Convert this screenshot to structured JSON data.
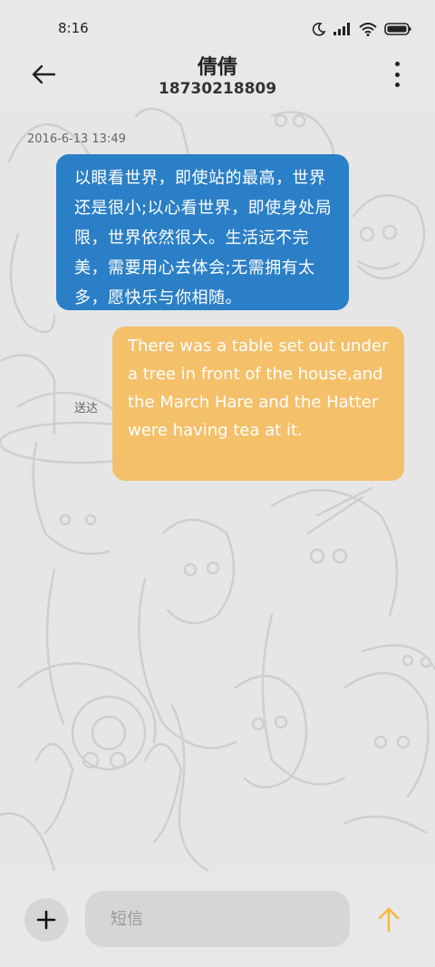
{
  "status_bar": {
    "time": "8:16",
    "icons": [
      "moon-icon",
      "signal-icon",
      "wifi-icon",
      "battery-icon"
    ]
  },
  "header": {
    "title": "倩倩",
    "phone": "18730218809",
    "back_icon": "arrow-left-icon",
    "more_icon": "more-vertical-icon"
  },
  "messages": [
    {
      "direction": "incoming",
      "timestamp": "2016-6-13 13:49",
      "text": "以眼看世界，即使站的最高，世界还是很小;以心看世界，即使身处局限，世界依然很大。生活远不完美，需要用心去体会;无需拥有太多，愿快乐与你相随。",
      "color": "#2b7fc6"
    },
    {
      "direction": "outgoing",
      "status": "送达",
      "text": "There was a table set out under a tree in front of the house,and the March Hare and the Hatter were having tea at it.",
      "color": "#f5c06a"
    }
  ],
  "composer": {
    "placeholder": "短信",
    "add_icon": "plus-icon",
    "send_icon": "arrow-up-icon",
    "send_color": "#f5b942"
  }
}
